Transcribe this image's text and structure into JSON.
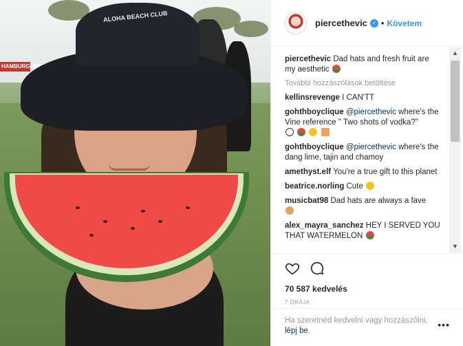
{
  "post": {
    "username": "piercethevic",
    "follow_label": "Követem",
    "dot": "•",
    "verified_icon": "verified-badge-icon",
    "photo_hat_text": "ALOHA BEACH CLUB",
    "photo_sign_text": "HAMBURGERS"
  },
  "caption": {
    "username": "piercethevic",
    "text": "Dad hats and fresh fruit are my aesthetic"
  },
  "load_more_label": "További hozzászólások betöltése",
  "comments": [
    {
      "user": "kellinsrevenge",
      "text": "I CAN'TT"
    },
    {
      "user": "gohthboyclique",
      "mention": "@piercethevic",
      "text": "where's the Vine reference \" Two shots of vodka?\""
    },
    {
      "user": "gohthboyclique",
      "mention": "@piercethevic",
      "text": "where's the dang lime, tajin and chamoy"
    },
    {
      "user": "amethyst.elf",
      "text": "You're a true gift to this planet"
    },
    {
      "user": "beatrice.norling",
      "text": "Cute"
    },
    {
      "user": "musicbat98",
      "text": "Dad hats are always a fave"
    },
    {
      "user": "alex_mayra_sanchez",
      "text": "HEY I SERVED YOU THAT WATERMELON"
    }
  ],
  "likes_text": "70 587 kedvelés",
  "time_text": "7 ÓRÁJA",
  "login": {
    "prefix": "Ha szeretnéd kedvelni vagy hozzászólni,",
    "link": "lépj be",
    "suffix": "."
  },
  "options_label": "•••",
  "colors": {
    "accent": "#3897f0",
    "link": "#003569",
    "muted": "#999999",
    "watermelon": "#ef4a48"
  }
}
